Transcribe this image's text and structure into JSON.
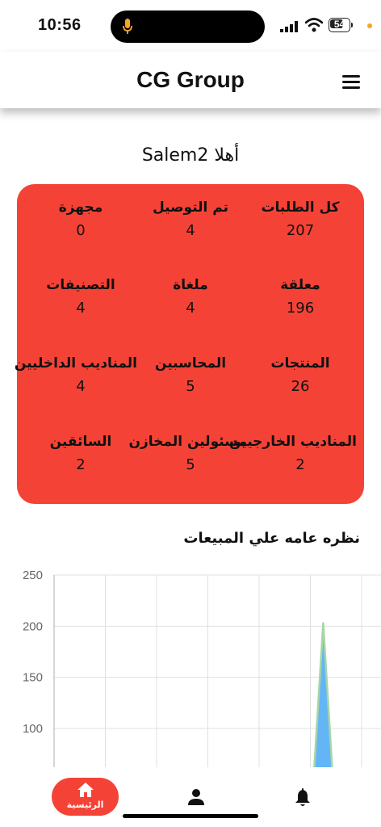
{
  "status_bar": {
    "time": "10:56",
    "battery": "54",
    "icons": [
      "microphone-icon",
      "signal-icon",
      "wifi-icon",
      "battery-icon"
    ]
  },
  "app_bar": {
    "title": "CG Group",
    "menu_icon": "hamburger-menu-icon"
  },
  "greeting": "أهلا Salem2",
  "stats": [
    {
      "label": "كل الطلبات",
      "value": "207"
    },
    {
      "label": "تم التوصيل",
      "value": "4"
    },
    {
      "label": "مجهزة",
      "value": "0"
    },
    {
      "label": "معلقة",
      "value": "196"
    },
    {
      "label": "ملغاة",
      "value": "4"
    },
    {
      "label": "التصنيفات",
      "value": "4"
    },
    {
      "label": "المنتجات",
      "value": "26"
    },
    {
      "label": "المحاسبين",
      "value": "5"
    },
    {
      "label": "المناديب الداخليين",
      "value": "4"
    },
    {
      "label": "المناديب الخارجيين",
      "value": "2"
    },
    {
      "label": "مسئولين المخازن",
      "value": "5"
    },
    {
      "label": "السائقين",
      "value": "2"
    }
  ],
  "colors": {
    "card": "#f44336",
    "area_fill": "#64b5f6",
    "area_stroke": "#a5d6a7",
    "grid": "#e0e0e0"
  },
  "chart_title": "نظره عامه علي المبيعات",
  "chart_data": {
    "type": "area",
    "title": "نظره عامه علي المبيعات",
    "xlabel": "",
    "ylabel": "",
    "yticks": [
      "250",
      "200",
      "150",
      "100"
    ],
    "ylim": [
      60,
      250
    ],
    "xlim": [
      0,
      6
    ],
    "grid": true,
    "series": [
      {
        "x": [
          5,
          5.25,
          5.5
        ],
        "y": [
          0,
          203,
          0
        ]
      }
    ]
  },
  "bottom_nav": {
    "home_label": "الرئيسية",
    "home_icon": "home-icon",
    "profile_icon": "person-icon",
    "notifications_icon": "bell-icon"
  }
}
